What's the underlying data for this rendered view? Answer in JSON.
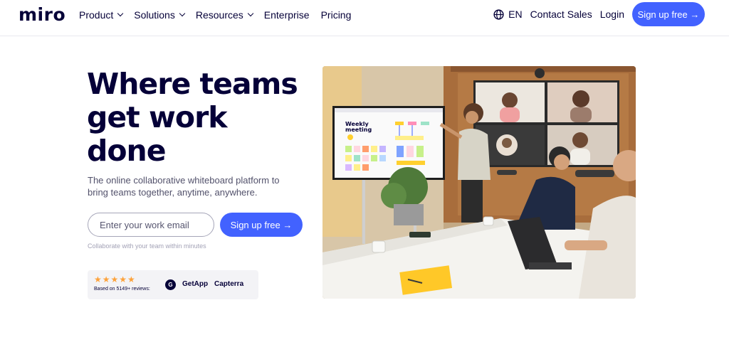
{
  "brand": {
    "logo": "miro",
    "accent": "#4262ff",
    "ink": "#050038"
  },
  "nav": {
    "items": [
      {
        "label": "Product",
        "dropdown": true
      },
      {
        "label": "Solutions",
        "dropdown": true
      },
      {
        "label": "Resources",
        "dropdown": true
      },
      {
        "label": "Enterprise",
        "dropdown": false
      },
      {
        "label": "Pricing",
        "dropdown": false
      }
    ],
    "language": "EN",
    "contact_sales": "Contact Sales",
    "login": "Login",
    "signup": "Sign up free →"
  },
  "hero": {
    "title_line1": "Where teams",
    "title_line2": "get work",
    "title_line3": "done",
    "subtitle": "The online collaborative whiteboard platform to bring teams together, anytime, anywhere.",
    "email_placeholder": "Enter your work email",
    "signup_label": "Sign up free →",
    "note": "Collaborate with your team within minutes"
  },
  "ratings": {
    "stars": "★★★★★",
    "stars_value": 4.5,
    "reviews_text": "Based on 5149+ reviews:",
    "logos": [
      "GetApp",
      "Capterra"
    ],
    "g2_mark": "G"
  },
  "photo": {
    "board_title_line1": "Weekly",
    "board_title_line2": "meeting"
  }
}
